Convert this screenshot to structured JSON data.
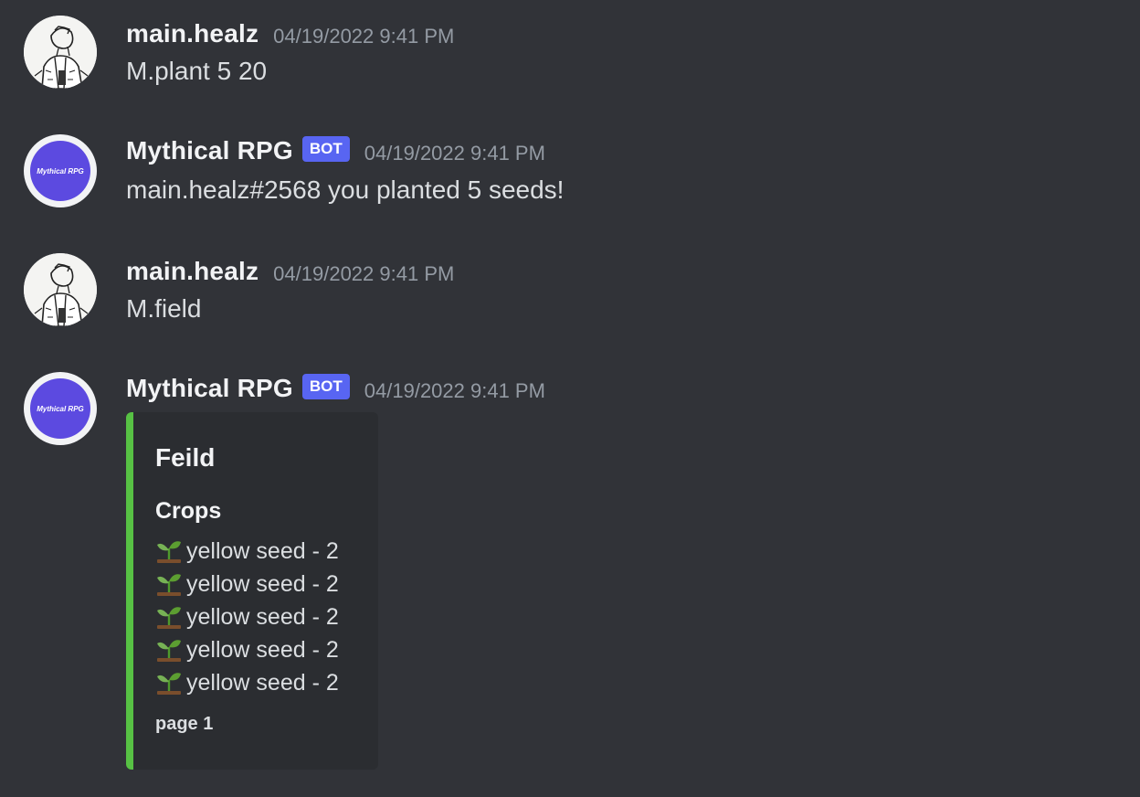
{
  "messages": [
    {
      "username": "main.healz",
      "timestamp": "04/19/2022 9:41 PM",
      "content": "M.plant 5 20"
    },
    {
      "username": "Mythical RPG",
      "bot_tag": "BOT",
      "avatar_text": "Mythical RPG",
      "timestamp": "04/19/2022 9:41 PM",
      "content": "main.healz#2568 you planted 5 seeds!"
    },
    {
      "username": "main.healz",
      "timestamp": "04/19/2022 9:41 PM",
      "content": "M.field"
    },
    {
      "username": "Mythical RPG",
      "bot_tag": "BOT",
      "avatar_text": "Mythical RPG",
      "timestamp": "04/19/2022 9:41 PM",
      "embed": {
        "accent_color": "#57c144",
        "title": "Feild",
        "field_name": "Crops",
        "items": [
          {
            "icon": "seedling-icon",
            "text": "yellow seed - 2"
          },
          {
            "icon": "seedling-icon",
            "text": "yellow seed - 2"
          },
          {
            "icon": "seedling-icon",
            "text": "yellow seed - 2"
          },
          {
            "icon": "seedling-icon",
            "text": "yellow seed - 2"
          },
          {
            "icon": "seedling-icon",
            "text": "yellow seed - 2"
          }
        ],
        "footer": "page 1"
      }
    }
  ],
  "colors": {
    "background": "#313338",
    "bot_tag": "#5865f2",
    "bot_avatar": "#5c4ae0",
    "embed_background": "#2b2d31"
  }
}
